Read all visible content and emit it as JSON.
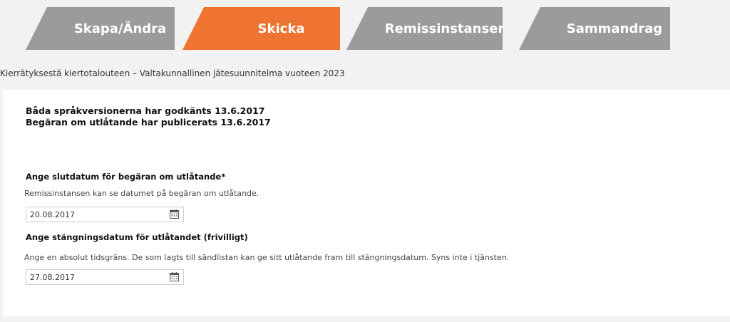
{
  "steps": [
    {
      "label": "Skapa/Ändra",
      "active": false
    },
    {
      "label": "Skicka",
      "active": true
    },
    {
      "label": "Remissinstanser",
      "active": false
    },
    {
      "label": "Sammandrag",
      "active": false
    }
  ],
  "accent_color": "#f07431",
  "inactive_step_color": "#9b9b9b",
  "process_title": "Kierrätyksestä kiertotalouteen – Valtakunnallinen jätesuunnitelma vuoteen 2023",
  "status": {
    "line1": "Båda språkversionerna har godkänts 13.6.2017",
    "line2": "Begäran om utlåtande har publicerats 13.6.2017"
  },
  "deadline": {
    "label": "Ange slutdatum för begäran om utlåtande*",
    "help": "Remissinstansen kan se datumet på begäran om utlåtande.",
    "value": "20.08.2017",
    "icon": "calendar-icon"
  },
  "closing": {
    "label": "Ange stängningsdatum för utlåtandet (frivilligt)",
    "help": "Ange en absolut tidsgräns. De som lagts till sändlistan kan ge sitt utlåtande fram till stängningsdatum. Syns inte i tjänsten.",
    "value": "27.08.2017",
    "icon": "calendar-icon"
  }
}
